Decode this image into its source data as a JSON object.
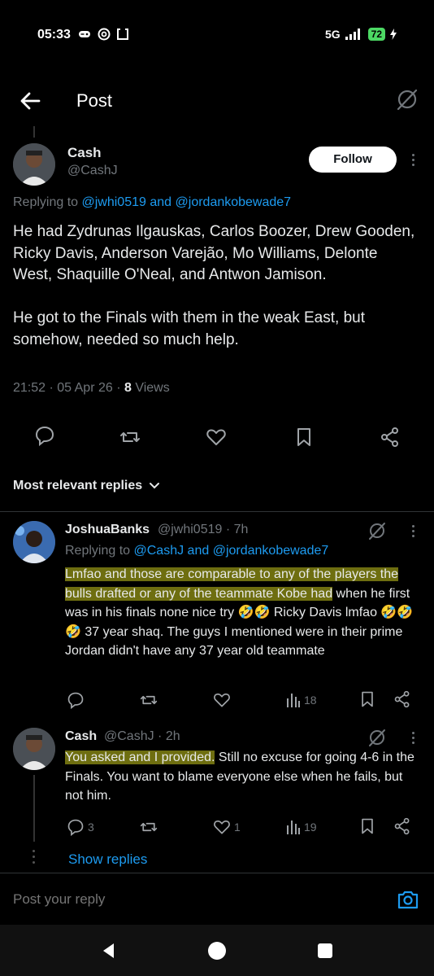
{
  "status_bar": {
    "time": "05:33",
    "network": "5G",
    "battery": "72"
  },
  "top_bar": {
    "title": "Post"
  },
  "post": {
    "author_name": "Cash",
    "author_handle": "@CashJ",
    "follow_label": "Follow",
    "replying_prefix": "Replying to",
    "replying_to_1": "@jwhi0519",
    "replying_and": "and",
    "replying_to_2": "@jordankobewade7",
    "text": "He had Zydrunas Ilgauskas, Carlos Boozer, Drew Gooden, Ricky Davis, Anderson Varejão, Mo Williams, Delonte West, Shaquille O'Neal, and Antwon Jamison.\n\nHe got to the Finals with them in the weak East, but somehow, needed so much help.",
    "timestamp": "21:52 · 05 Apr 26 · ",
    "views_count": "8",
    "views_label": " Views"
  },
  "sort": {
    "label": "Most relevant replies"
  },
  "replies": [
    {
      "author_name": "JoshuaBanks",
      "author_handle": "@jwhi0519 · 7h",
      "replying_prefix": "Replying to",
      "replying_to_1": "@CashJ",
      "replying_and": "and",
      "replying_to_2": "@jordankobewade7",
      "text_highlighted": "Lmfao and those are comparable to any of the players the bulls drafted or any of the teammate Kobe had",
      "text_rest": " when he first was in his finals none nice try 🤣🤣 Ricky Davis lmfao 🤣🤣🤣 37 year shaq. The guys I mentioned were in their prime Jordan didn't have any 37 year old teammate",
      "replies_count": "",
      "reposts_count": "",
      "likes_count": "",
      "views_count": "18"
    },
    {
      "author_name": "Cash",
      "author_handle": "@CashJ · 2h",
      "text_highlighted": "You asked and I provided.",
      "text_rest": " Still no excuse for going 4-6 in the Finals. You want to blame everyone else when he fails, but not him.",
      "replies_count": "3",
      "reposts_count": "",
      "likes_count": "1",
      "views_count": "19"
    }
  ],
  "show_replies_label": "Show replies",
  "compose": {
    "placeholder": "Post your reply"
  },
  "colors": {
    "accent": "#1d9bf0",
    "highlight": "#c8c81e",
    "background": "#000000",
    "muted": "#71767b"
  }
}
